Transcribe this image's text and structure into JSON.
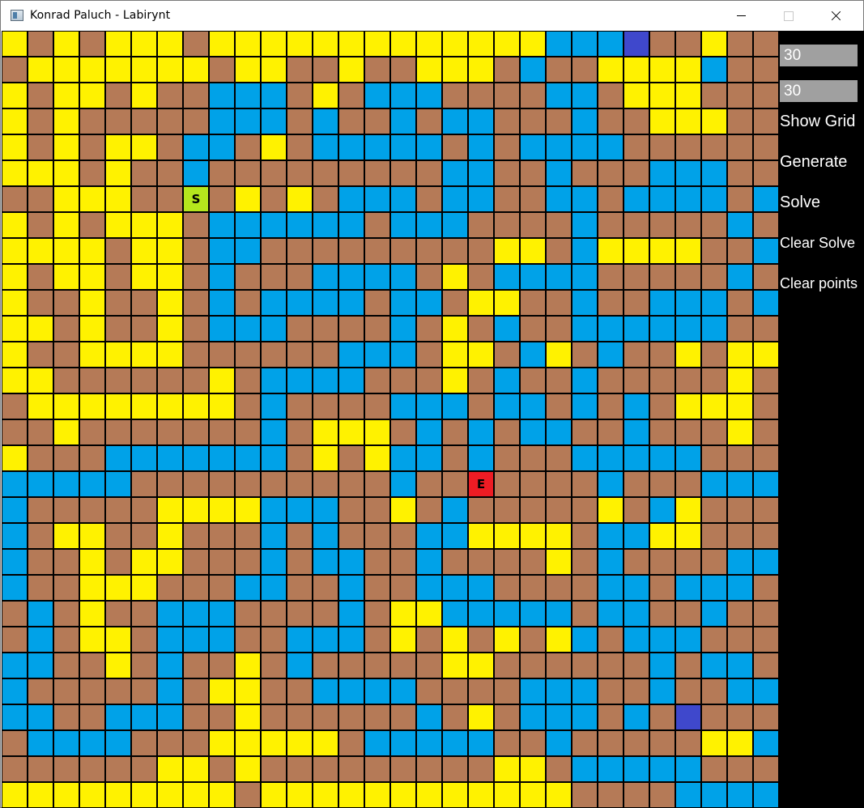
{
  "window": {
    "title": "Konrad Paluch - Labirynt"
  },
  "panel": {
    "rows_value": "30",
    "cols_value": "30",
    "buttons": {
      "show_grid": "Show Grid",
      "generate": "Generate",
      "solve": "Solve",
      "clear_solve": "Clear Solve",
      "clear_points": "Clear points"
    }
  },
  "maze": {
    "rows": 30,
    "cols": 30,
    "legend": {
      "w": "wall",
      "y": "open",
      "b": "open-alt",
      "p": "marked",
      "s": "start",
      "e": "end"
    },
    "colors": {
      "w": "#b57a57",
      "y": "#fff200",
      "b": "#00a2e8",
      "p": "#3f48cc",
      "s": "#b5e61d",
      "e": "#ed1c24",
      "gap": "#000000"
    },
    "start_label": "S",
    "end_label": "E",
    "cells": [
      "ywywyyywyyyyyyyyyyyyybbbpwwy",
      "wyyyyyyywyywwywwyyywbwwyyyyb",
      "ywyywywwbbbwywbbbwwwwbbwyyyw",
      "ywywwwwwbbbwbwwbwbbwwwbwwyyy",
      "ywywyywbbwywbbbbbwbwbbbbwwwww",
      "yyywywwbwwwwwwwwwbbwwbwwwbbb",
      "wwyyywwswywywbbbwbbwwbbwbbbbwb",
      "ywywyyywbbbbbbwbbbwwwwbwwwwwb",
      "yyyywyywbbwwwwwwwwwyywbyyyywwb",
      "ywyywyywbwwwbbbbwywbbbbwwwwwb",
      "ywwywwywbwbbbbwbbwyywwbwwbbbwbb",
      "yywywwywbbbwwwwbwywbwwbbbbbbw",
      "ywwyyyywwwwwwbbbwyywbywbwwywyy",
      "yywwwwwwywbbbbwwwywbwwbwwwwwy",
      "wyyyyyyyywbwwwwbbbwbbwbwbwyyy",
      "wwywwwwwwwbwyyywbwbwbbwwbwwwyw",
      "ywwwbbbbbbbwywybbwbwwwbbbbbww",
      "bbbbbwwwwwwwwwwbwwewwwwbwwwbbb",
      "bwwwwwyyyybbbwwywbwwwwwywbywwwb",
      "bwyywwywwwbwbwwwbbyyyywbbyywwwb",
      "bwwywyywwwbwbbwwbwwwwywbwwwwbbb",
      "bwwyyywwwbbwwbwwbbbwwwwbbwbbbwb",
      "wbwywwbbbwwwwbwyybbbbbwbbwwb",
      "wbwyywbbbwwbbbwywywywybwbbbww",
      "bbwwywbwwywbwwwwwyywwwwwwbwbb",
      "bwwwwwbwyywwbbbbwwwwbbbwwbwwbbb",
      "bbwwbbbwwywwwwwwbwywbbbwbwpwwwwb",
      "wbbbbwwwyyyyywbbbbbwwbwwwwwyyb",
      "wwwwwwyywywwwwwwwwwyywbbbbbwwwb",
      "yyyyyyyyywyyyyyyyyyyyywwwwbbbbbb"
    ]
  }
}
